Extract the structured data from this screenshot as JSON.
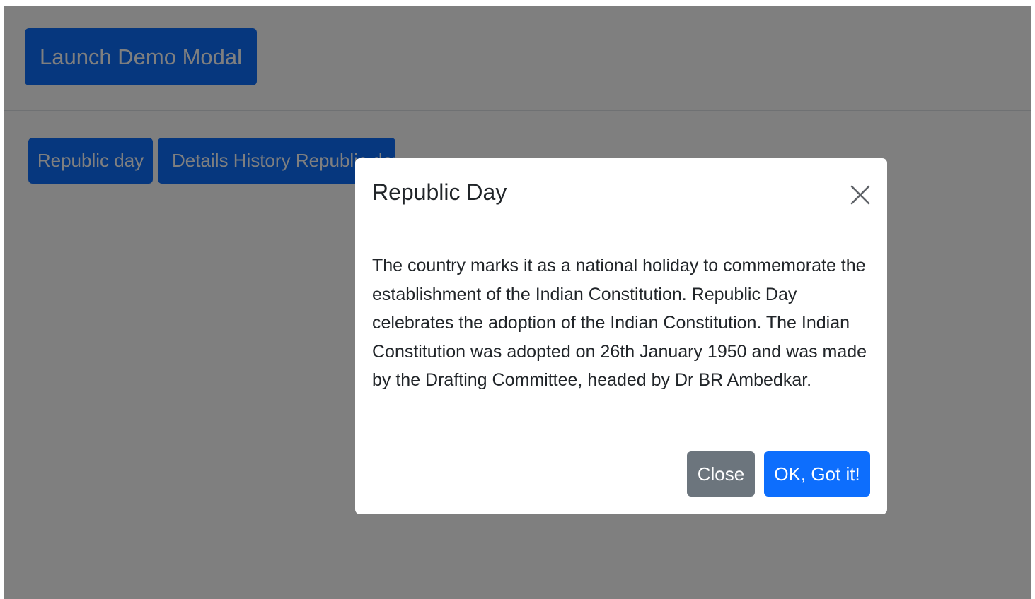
{
  "launch_button": {
    "label": "Launch Demo Modal"
  },
  "tabs": [
    {
      "label": "Republic day"
    },
    {
      "label": "Details History Republic day"
    }
  ],
  "modal": {
    "title": "Republic Day",
    "close_icon": "close-icon",
    "body": "The country marks it as a national holiday to commemorate the establishment of the Indian Constitution. Republic Day celebrates the adoption of the Indian Constitution. The Indian Constitution was adopted on 26th January 1950 and was made by the Drafting Committee, headed by Dr BR Ambedkar.",
    "close_label": "Close",
    "ok_label": "OK, Got it!"
  },
  "colors": {
    "primary": "#0d6efd",
    "secondary": "#6c757d",
    "backdrop": "rgba(0,0,0,0.5)"
  }
}
